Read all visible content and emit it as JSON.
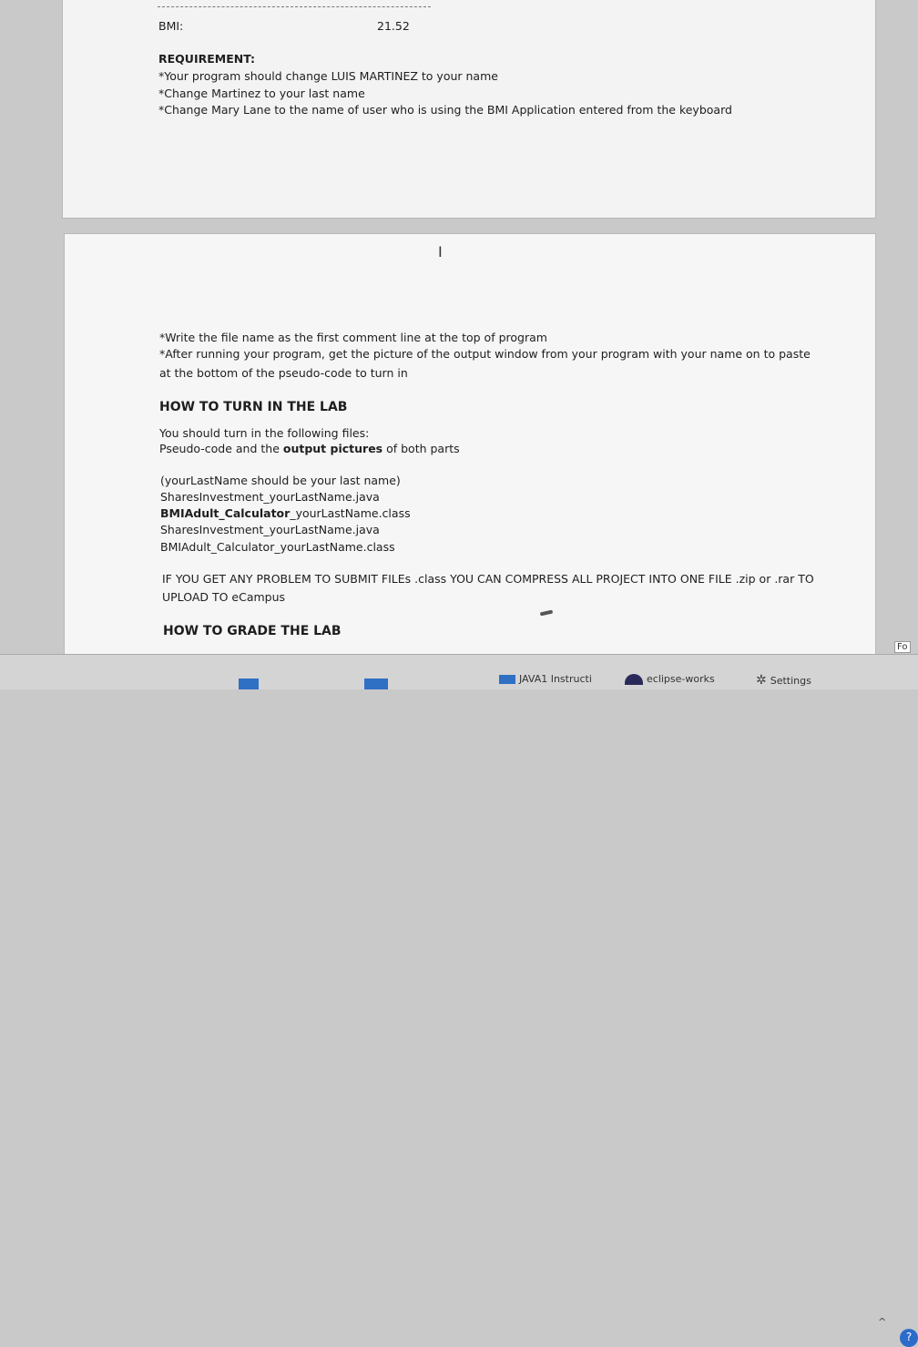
{
  "page1": {
    "bmi_label": "BMI:",
    "bmi_value": "21.52",
    "requirement_heading": "REQUIREMENT:",
    "req_lines": [
      "*Your program should change LUIS MARTINEZ to your name",
      "*Change Martinez to your last name",
      "*Change Mary Lane to the name of user who is using the BMI Application  entered from the keyboard"
    ]
  },
  "page2": {
    "instructions": [
      "*Write the file name as the first comment line at the top of program",
      "*After running your program, get the picture of the output window from your program with your name on to paste",
      "at the bottom of the pseudo-code to turn in"
    ],
    "turn_in_heading": "HOW TO TURN IN THE LAB",
    "turn_in_line1": "You should turn in the following files:",
    "turn_in_line2_pre": "Pseudo-code and the ",
    "turn_in_line2_bold": "output pictures",
    "turn_in_line2_post": " of both parts",
    "lastname_note": "(yourLastName should be your last name)",
    "file1": "SharesInvestment_yourLastName.java",
    "file2_bold": "BMIAdult_Calculator",
    "file2_rest": "_yourLastName.class",
    "file3": "SharesInvestment_yourLastName.java",
    "file4": "BMIAdult_Calculator_yourLastName.class",
    "problem_line1": "IF YOU GET ANY PROBLEM TO SUBMIT FILEs .class YOU CAN COMPRESS ALL PROJECT INTO ONE FILE .zip or .rar TO",
    "problem_line2": "UPLOAD TO eCampus",
    "grade_heading": "HOW TO GRADE THE LAB"
  },
  "taskbar": {
    "java_item": "JAVA1 Instructi",
    "eclipse_item": "eclipse-works",
    "settings_item": "Settings",
    "fo_label": "Fo"
  }
}
